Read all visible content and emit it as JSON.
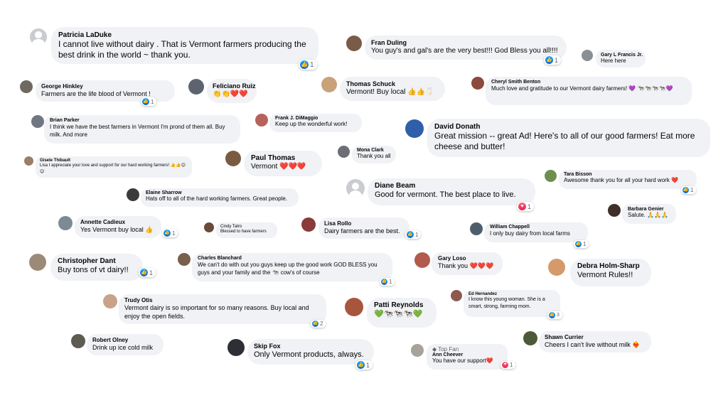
{
  "comments": [
    {
      "name": "Patricia LaDuke",
      "text": "I cannot live without dairy . That is Vermont farmers producing the best drink in the world ~ thank you.",
      "reactions": "1",
      "reaction_icon": "like-icon"
    },
    {
      "name": "Fran Duling",
      "text": "You guy's and gal's are the very best!!! God Bless you all!!!!",
      "reactions": "1",
      "reaction_icon": "like-icon"
    },
    {
      "name": "Gary L Francis Jr.",
      "text": "Here here"
    },
    {
      "name": "George Hinkley",
      "text": "Farmers are the life blood of Vermont !",
      "reactions": "1",
      "reaction_icon": "like-icon"
    },
    {
      "name": "Feliciano Ruiz",
      "text": "👏👏❤️❤️"
    },
    {
      "name": "Thomas Schuck",
      "text": "Vermont! Buy local 👍👍🥛"
    },
    {
      "name": "Cheryl Smith Benton",
      "text": "Much love and gratitude to our Vermont dairy farmers! 💜 🐄🐄🐄🐄💜"
    },
    {
      "name": "Brian Parker",
      "text": "I think we have the best farmers in Vermont I'm prond of them all. Buy milk. And more"
    },
    {
      "name": "Frank J. DiMaggio",
      "text": "Keep up the wonderful work!"
    },
    {
      "name": "David Donath",
      "text": "Great mission -- great Ad! Here's to all of our good farmers! Eat more cheese and butter!"
    },
    {
      "name": "Gisele Thibault",
      "text": "Lisa I appreciate your love and support for our hard working farmers! 👍👍😊😊"
    },
    {
      "name": "Paul Thomas",
      "text": "Vermont ❤️❤️❤️"
    },
    {
      "name": "Mona Clark",
      "text": "Thank you all"
    },
    {
      "name": "Diane Beam",
      "text": "Good for vermont. The best place to live.",
      "reactions": "1",
      "reaction_icon": "love-icon"
    },
    {
      "name": "Tara Bisson",
      "text": "Awesome thank you for all your hard work ❤️",
      "reactions": "1",
      "reaction_icon": "like-icon"
    },
    {
      "name": "Elaine Sharrow",
      "text": "Hats off to all of the hard working farmers. Great people."
    },
    {
      "name": "Barbara Genier",
      "text": "Salute. 🙏🙏🙏"
    },
    {
      "name": "Annette Cadieux",
      "text": "Yes Vermont buy local 👍",
      "reactions": "1",
      "reaction_icon": "like-icon"
    },
    {
      "name": "Cindy Tatro",
      "text": "Blessed to have farmers"
    },
    {
      "name": "Lisa Rollo",
      "text": "Dairy farmers are the best.",
      "reactions": "1",
      "reaction_icon": "like-icon"
    },
    {
      "name": "William Chappell",
      "text": "I only buy dairy from local farms",
      "reactions": "1",
      "reaction_icon": "like-icon"
    },
    {
      "name": "Christopher Dant",
      "text": "Buy tons of vt dairy!!",
      "reactions": "1",
      "reaction_icon": "like-icon"
    },
    {
      "name": "Charles Blanchard",
      "text": "We can't do with out you guys keep up the good work GOD BLESS you guys and your family and the 🐄 cow's of course",
      "reactions": "1",
      "reaction_icon": "like-icon"
    },
    {
      "name": "Gary Loso",
      "text": "Thank you ❤️❤️❤️"
    },
    {
      "name": "Debra Holm-Sharp",
      "text": "Vermont Rules!!"
    },
    {
      "name": "Trudy Otis",
      "text": "Vermont dairy is so important for so many reasons. Buy local and enjoy the open fields.",
      "reactions": "2",
      "reaction_icon": "like-icon"
    },
    {
      "name": "Patti Reynolds",
      "text": "💚🐄🐄🐄💚"
    },
    {
      "name": "Ed Hernandez",
      "text": "I know this young woman. She is a smart, strong, farming mom.",
      "reactions": "3",
      "reaction_icon": "like-icon"
    },
    {
      "name": "Robert Olney",
      "text": "Drink up ice cold milk"
    },
    {
      "name": "Skip Fox",
      "text": "Only Vermont products, always.",
      "reactions": "1",
      "reaction_icon": "like-icon"
    },
    {
      "name": "Ann Cheever",
      "badge": "Top Fan",
      "text": "You have our support❤️",
      "reactions": "1",
      "reaction_icon": "love-icon"
    },
    {
      "name": "Shawn Currier",
      "text": "Cheers I can't live without milk ❤️‍🔥"
    }
  ]
}
